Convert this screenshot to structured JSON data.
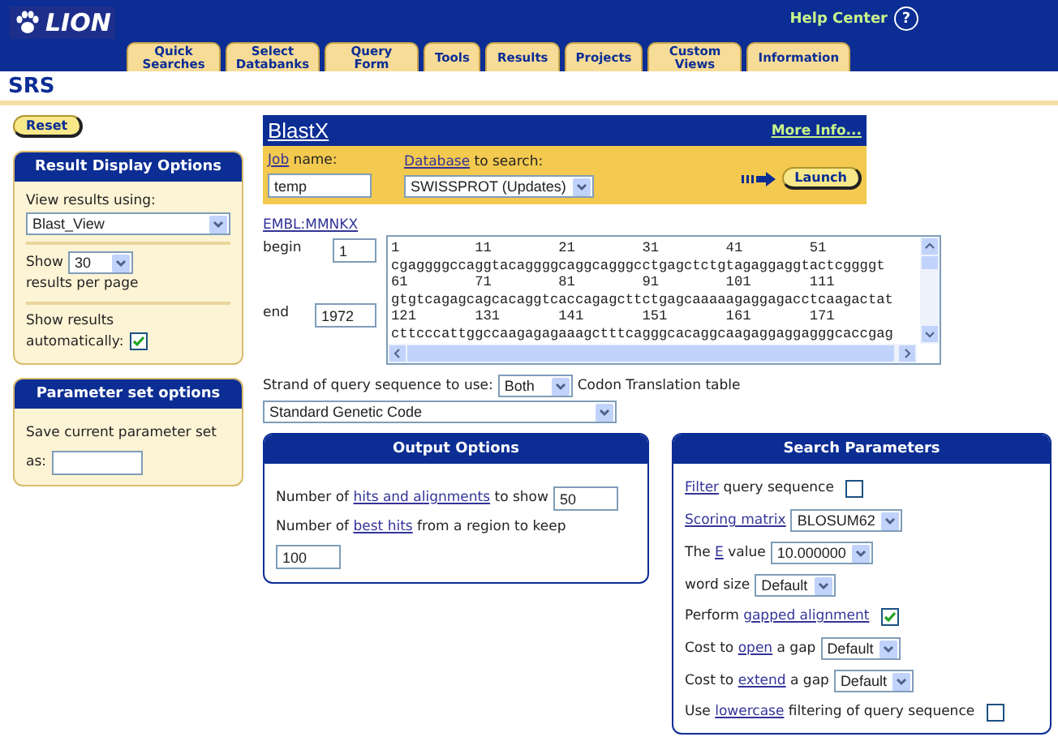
{
  "header": {
    "logo": "LION",
    "help": "Help Center",
    "help_icon": "?"
  },
  "tabs": [
    {
      "label": "Quick Searches",
      "selected": false
    },
    {
      "label": "Select Databanks",
      "selected": false
    },
    {
      "label": "Query Form",
      "selected": false
    },
    {
      "label": "Tools",
      "selected": false
    },
    {
      "label": "Results",
      "selected": false
    },
    {
      "label": "Projects",
      "selected": false
    },
    {
      "label": "Custom Views",
      "selected": false
    },
    {
      "label": "Information",
      "selected": false
    }
  ],
  "app_title": "SRS",
  "reset": "Reset",
  "result_display": {
    "title": "Result Display Options",
    "view_label": "View results using:",
    "view_value": "Blast_View",
    "show_label": "Show",
    "show_value": "30",
    "per_page": "results per page",
    "auto_label": "Show results automatically:",
    "auto_checked": true
  },
  "parameter_set": {
    "title": "Parameter set options",
    "save_label": "Save current parameter set",
    "as_label": "as:"
  },
  "blast": {
    "title": "BlastX",
    "more_info": "More Info...",
    "job_label": {
      "link": "Job",
      "post": " name:"
    },
    "job_value": "temp",
    "db_label": {
      "link": "Database",
      "post": " to search:"
    },
    "db_value": "SWISSPROT (Updates)",
    "launch": "Launch"
  },
  "sequence": {
    "id": "EMBL:MMNKX",
    "begin_label": "begin",
    "begin_value": "1",
    "end_label": "end",
    "end_value": "1972",
    "lines": [
      "1         11        21        31        41        51",
      "cgaggggccaggtacaggggcaggcagggcctgagctctgtagaggaggtactcggggt",
      "61        71        81        91        101       111",
      "gtgtcagagcagcacaggtcaccagagcttctgagcaaaaagaggagacctcaagactat",
      "121       131       141       151       161       171",
      "cttcccattggccaagagagaaagctttcagggcacaggcaagaggaggagggcaccgag"
    ]
  },
  "strand": {
    "label": "Strand of query sequence to use:",
    "value": "Both",
    "codon_label": "Codon Translation table",
    "codon_value": "Standard Genetic Code"
  },
  "output_options": {
    "title": "Output Options",
    "hits_label": {
      "pre": "Number of ",
      "link": "hits and alignments",
      "post": " to show"
    },
    "hits_value": "50",
    "best_label": {
      "pre": "Number of ",
      "link": "best hits",
      "post": " from a region to keep"
    },
    "best_value": "100"
  },
  "search_parameters": {
    "title": "Search Parameters",
    "rows": [
      {
        "kind": "checkbox",
        "label": {
          "link": "Filter",
          "post": " query sequence"
        },
        "checked": false
      },
      {
        "kind": "select",
        "label": {
          "link": "Scoring matrix"
        },
        "value": "BLOSUM62"
      },
      {
        "kind": "select",
        "label": {
          "pre": "The ",
          "link": "E",
          "post": " value"
        },
        "value": "10.000000"
      },
      {
        "kind": "select",
        "label": {
          "pre": "word size"
        },
        "value": "Default"
      },
      {
        "kind": "checkbox",
        "label": {
          "pre": "Perform ",
          "link": "gapped alignment"
        },
        "checked": true
      },
      {
        "kind": "select",
        "label": {
          "pre": "Cost to ",
          "link": "open",
          "post": " a gap"
        },
        "value": "Default"
      },
      {
        "kind": "select",
        "label": {
          "pre": "Cost to ",
          "link": "extend",
          "post": " a gap"
        },
        "value": "Default"
      },
      {
        "kind": "checkbox",
        "label": {
          "pre": "Use ",
          "link": "lowercase",
          "post": " filtering of query sequence"
        },
        "checked": false
      }
    ]
  }
}
